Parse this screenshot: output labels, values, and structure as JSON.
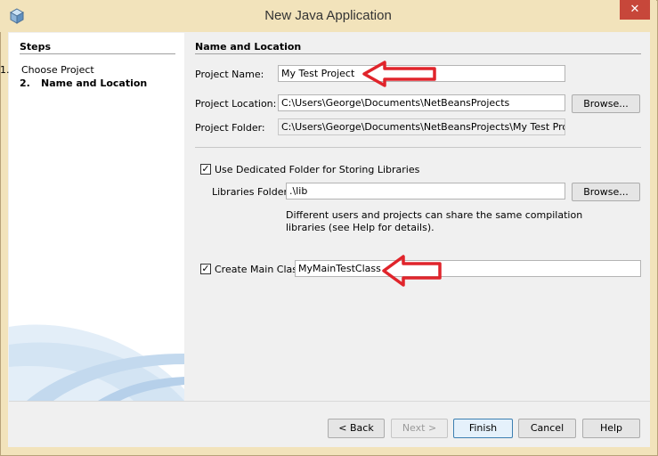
{
  "window": {
    "title": "New Java Application",
    "close_glyph": "✕"
  },
  "steps": {
    "heading": "Steps",
    "items": [
      {
        "num": "1.",
        "label": "Choose Project",
        "current": false
      },
      {
        "num": "2.",
        "label": "Name and Location",
        "current": true
      }
    ]
  },
  "form": {
    "heading": "Name and Location",
    "project_name": {
      "label": "Project Name:",
      "value": "My Test Project"
    },
    "project_location": {
      "label": "Project Location:",
      "value": "C:\\Users\\George\\Documents\\NetBeansProjects",
      "browse": "Browse..."
    },
    "project_folder": {
      "label": "Project Folder:",
      "value": "C:\\Users\\George\\Documents\\NetBeansProjects\\My Test Project"
    },
    "dedicated_folder": {
      "label": "Use Dedicated Folder for Storing Libraries",
      "checked": true
    },
    "libraries_folder": {
      "label": "Libraries Folder:",
      "value": ".\\lib",
      "browse": "Browse..."
    },
    "libraries_note_line1": "Different users and projects can share the same compilation",
    "libraries_note_line2": "libraries (see Help for details).",
    "main_class": {
      "label": "Create Main Class",
      "checked": true,
      "value": "MyMainTestClass"
    }
  },
  "buttons": {
    "back": "< Back",
    "next": "Next >",
    "finish": "Finish",
    "cancel": "Cancel",
    "help": "Help"
  },
  "colors": {
    "annotation_arrow": "#e0242b",
    "titlebar": "#f2e3bb",
    "close": "#c7473a"
  },
  "icons": {
    "app": "java-cube-icon",
    "annotation": "red-arrow-icon"
  }
}
